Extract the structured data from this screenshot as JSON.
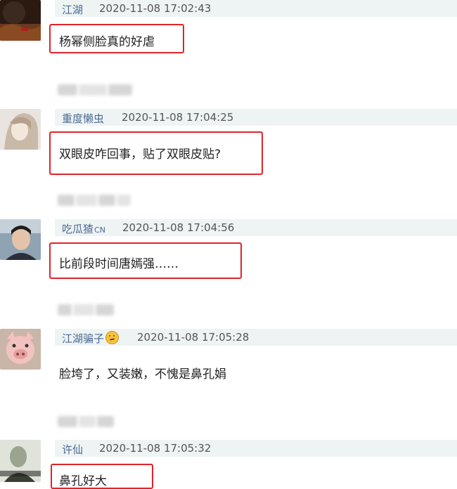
{
  "comments": [
    {
      "username": "江湖",
      "time": "2020-11-08 17:02:43",
      "text": "杨幂侧脸真的好虐",
      "highlighted": true,
      "avatar": "dark-red-landscape-avatar"
    },
    {
      "username": "重度懒虫",
      "time": "2020-11-08 17:04:25",
      "text": "双眼皮咋回事，贴了双眼皮贴?",
      "highlighted": true,
      "avatar": "girl-avatar"
    },
    {
      "username": "吃瓜猹",
      "username_suffix": "CN",
      "time": "2020-11-08 17:04:56",
      "text": "比前段时间唐嫣强……",
      "highlighted": true,
      "avatar": "man-photo-avatar"
    },
    {
      "username": "江湖骗子",
      "badge_icon": "emoji-face-icon",
      "time": "2020-11-08 17:05:28",
      "text": "脸垮了，又装嫩，不愧是鼻孔娟",
      "highlighted": false,
      "avatar": "pink-pig-avatar"
    },
    {
      "username": "许仙",
      "time": "2020-11-08 17:05:32",
      "text": "鼻孔好大",
      "highlighted": true,
      "avatar": "ink-portrait-avatar"
    }
  ],
  "colors": {
    "highlight": "#e0242a",
    "username": "#4a6b94",
    "meta_bg": "#eef3f3"
  }
}
